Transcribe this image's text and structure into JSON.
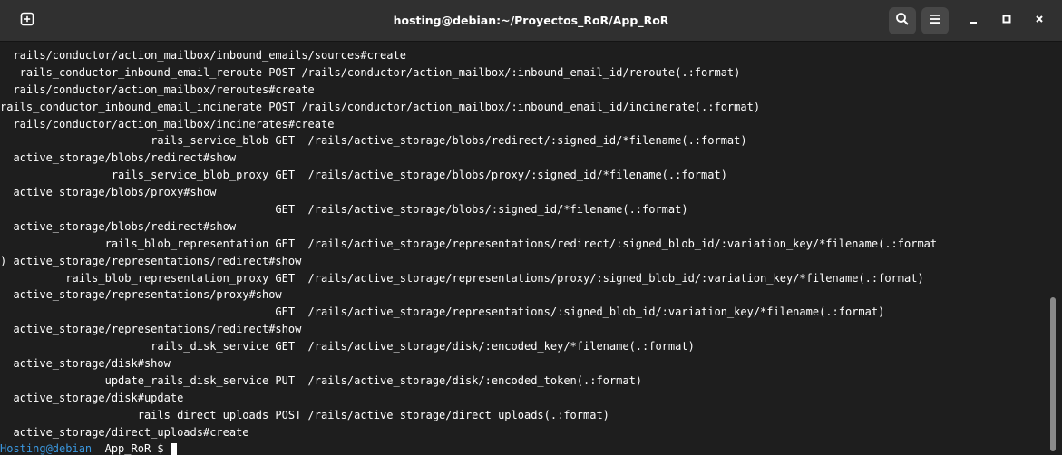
{
  "window": {
    "title": "hosting@debian:~/Proyectos_RoR/App_RoR"
  },
  "icons": {
    "new_tab": "new-tab-plus-icon",
    "search": "search-icon",
    "menu": "hamburger-menu-icon",
    "minimize": "minimize-icon",
    "maximize": "maximize-icon",
    "close": "close-icon"
  },
  "colors": {
    "titlebar_bg": "#303030",
    "terminal_bg": "#1e1e1e",
    "terminal_fg": "#ffffff",
    "prompt_host": "#3a96dd"
  },
  "terminal": {
    "lines": [
      "  rails/conductor/action_mailbox/inbound_emails/sources#create",
      "   rails_conductor_inbound_email_reroute POST /rails/conductor/action_mailbox/:inbound_email_id/reroute(.:format)",
      "  rails/conductor/action_mailbox/reroutes#create",
      "rails_conductor_inbound_email_incinerate POST /rails/conductor/action_mailbox/:inbound_email_id/incinerate(.:format)",
      "  rails/conductor/action_mailbox/incinerates#create",
      "                       rails_service_blob GET  /rails/active_storage/blobs/redirect/:signed_id/*filename(.:format)",
      "  active_storage/blobs/redirect#show",
      "                 rails_service_blob_proxy GET  /rails/active_storage/blobs/proxy/:signed_id/*filename(.:format)",
      "  active_storage/blobs/proxy#show",
      "                                          GET  /rails/active_storage/blobs/:signed_id/*filename(.:format)",
      "  active_storage/blobs/redirect#show",
      "                rails_blob_representation GET  /rails/active_storage/representations/redirect/:signed_blob_id/:variation_key/*filename(.:format",
      ") active_storage/representations/redirect#show",
      "          rails_blob_representation_proxy GET  /rails/active_storage/representations/proxy/:signed_blob_id/:variation_key/*filename(.:format)",
      "  active_storage/representations/proxy#show",
      "                                          GET  /rails/active_storage/representations/:signed_blob_id/:variation_key/*filename(.:format)",
      "  active_storage/representations/redirect#show",
      "                       rails_disk_service GET  /rails/active_storage/disk/:encoded_key/*filename(.:format)",
      "  active_storage/disk#show",
      "                update_rails_disk_service PUT  /rails/active_storage/disk/:encoded_token(.:format)",
      "  active_storage/disk#update",
      "                     rails_direct_uploads POST /rails/active_storage/direct_uploads(.:format)",
      "  active_storage/direct_uploads#create"
    ],
    "prompt": {
      "host": "Hosting@debian",
      "path": "  App_RoR",
      "symbol": " $ "
    }
  }
}
